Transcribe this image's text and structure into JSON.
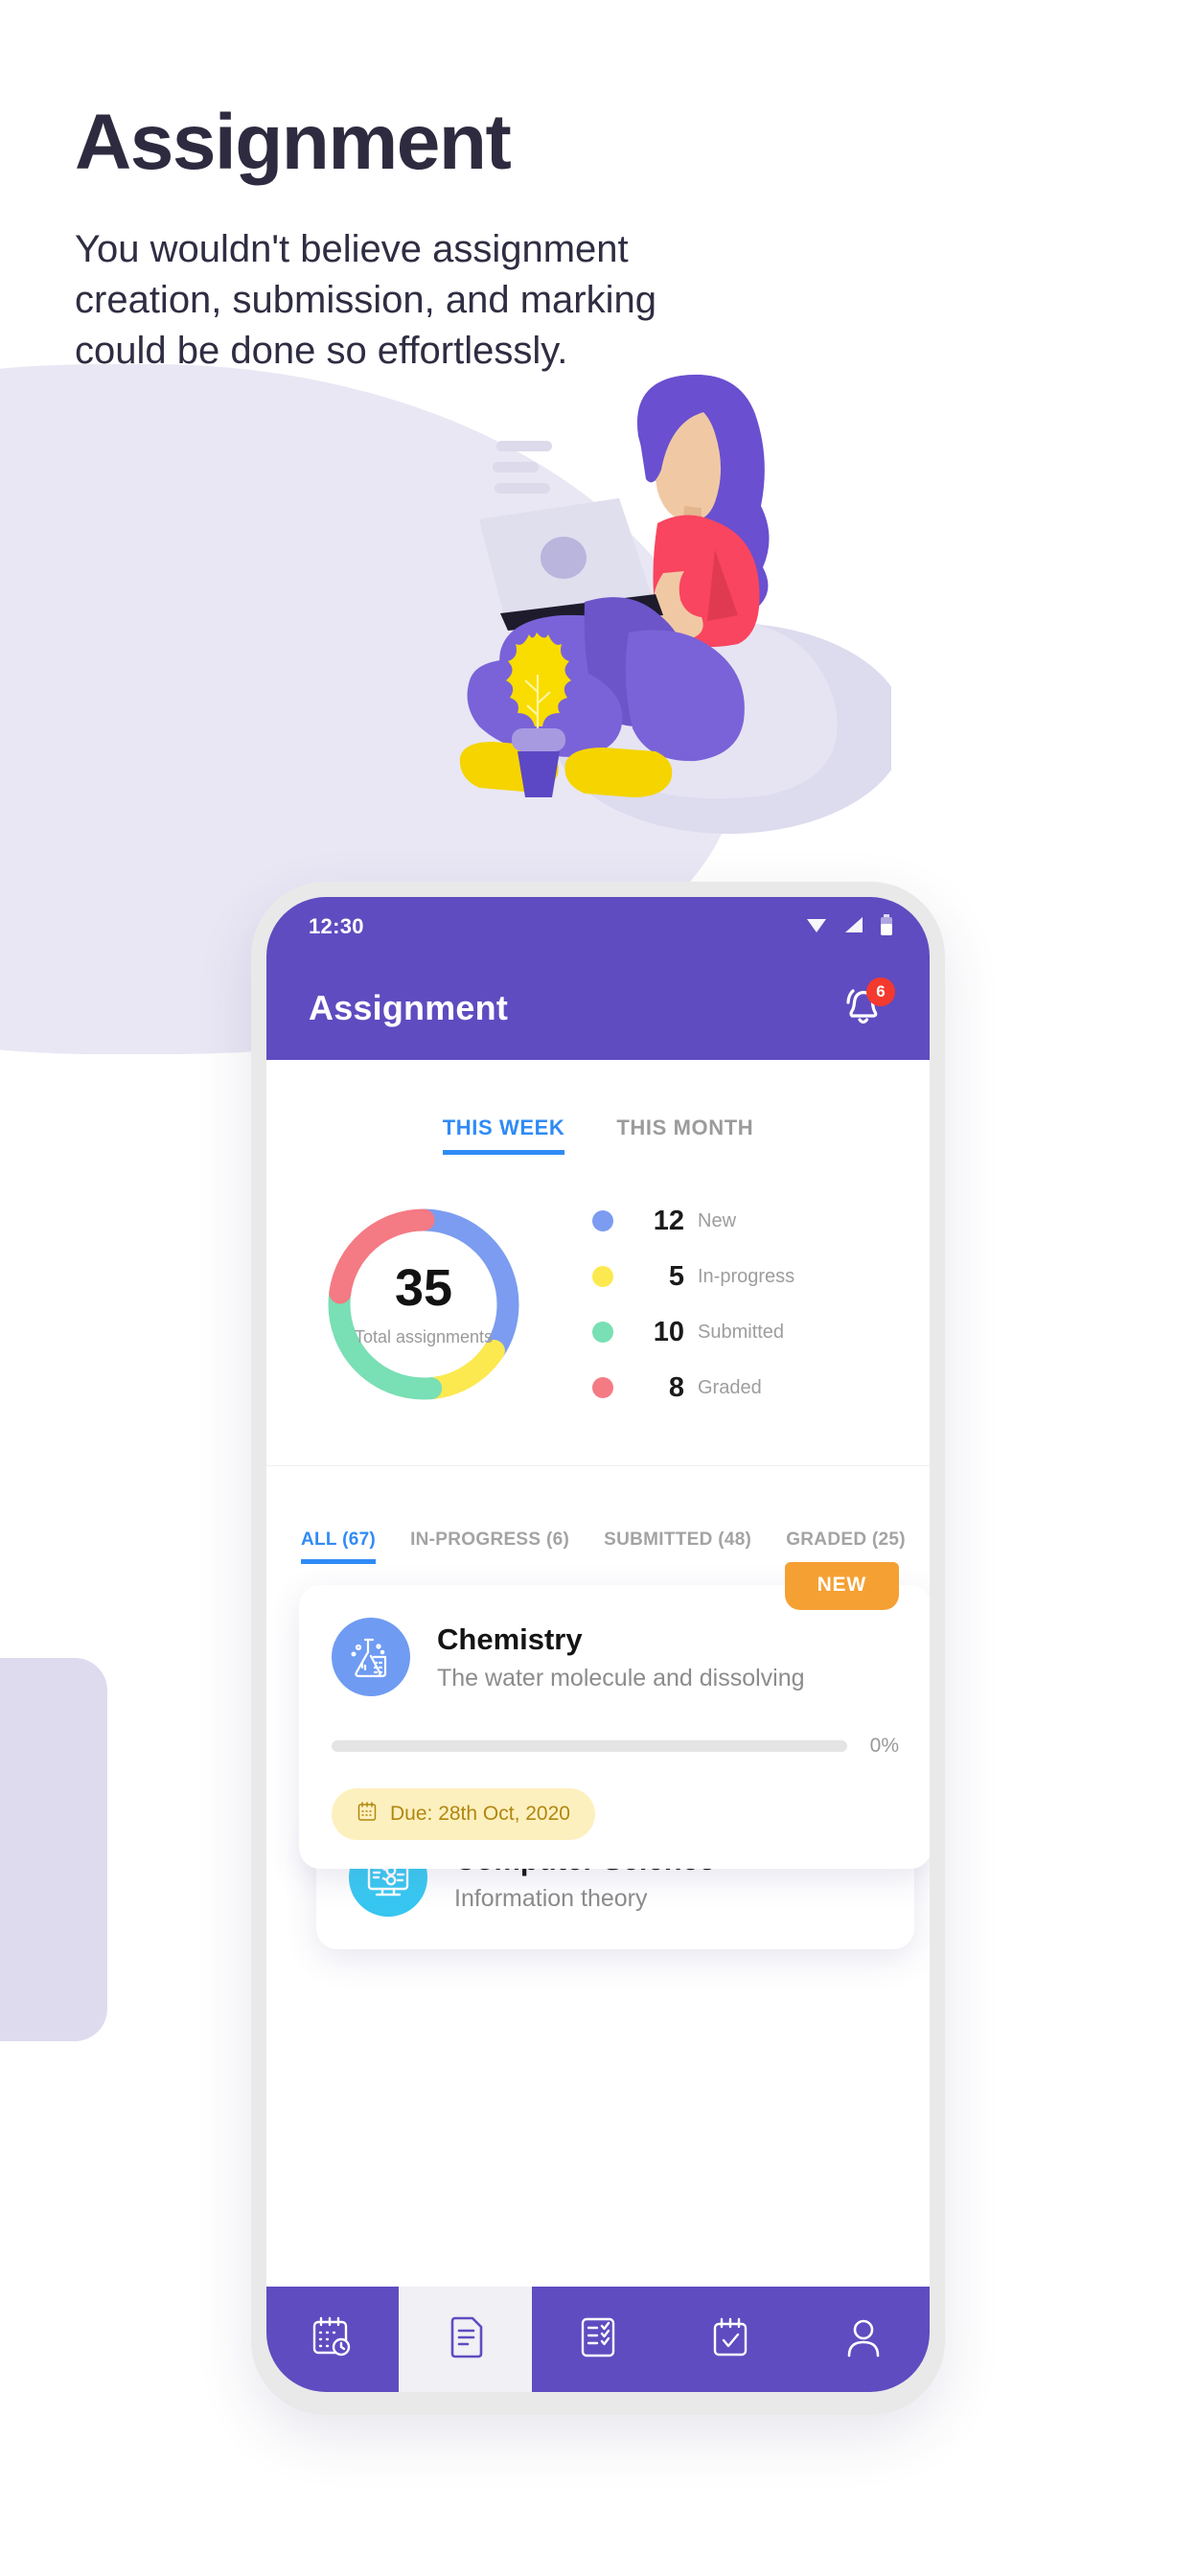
{
  "hero": {
    "title": "Assignment",
    "subtitle": "You wouldn't believe assignment creation, submission, and marking could be done so effortlessly."
  },
  "colors": {
    "brand_purple": "#5f4cc0",
    "accent_blue": "#2f8bf5",
    "badge_orange": "#f5a033",
    "badge_red": "#f4392f",
    "new": "#7b9cf0",
    "in_progress": "#fce94f",
    "submitted": "#79dfb4",
    "graded": "#f47a84",
    "due_pill_bg": "#fdf0bf",
    "due_pill_text": "#b0870f"
  },
  "phone": {
    "statusbar": {
      "time": "12:30",
      "icons": [
        "wifi-icon",
        "signal-icon",
        "battery-icon"
      ]
    },
    "appbar": {
      "title": "Assignment",
      "bell_icon": "bell-icon",
      "notification_count": "6"
    },
    "period_tabs": [
      {
        "label": "THIS WEEK",
        "active": true
      },
      {
        "label": "THIS MONTH",
        "active": false
      }
    ],
    "summary": {
      "total": "35",
      "total_label": "Total assignments"
    },
    "filter_tabs": [
      {
        "label": "ALL (67)",
        "active": true
      },
      {
        "label": "IN-PROGRESS (6)",
        "active": false
      },
      {
        "label": "SUBMITTED (48)",
        "active": false
      },
      {
        "label": "GRADED (25)",
        "active": false
      }
    ],
    "assignments": [
      {
        "subject": "Chemistry",
        "description": "The water molecule and dissolving",
        "icon": "chemistry-flask-icon",
        "badge": "NEW",
        "progress_pct": "0%",
        "progress_value": 0,
        "due": "Due: 28th Oct, 2020",
        "due_icon": "calendar-icon"
      },
      {
        "subject": "Computer Science",
        "description": "Information theory",
        "icon": "computer-monitor-icon"
      }
    ],
    "bottom_nav": [
      {
        "icon": "calendar-clock-icon",
        "active": false
      },
      {
        "icon": "document-icon",
        "active": true
      },
      {
        "icon": "checklist-icon",
        "active": false
      },
      {
        "icon": "calendar-check-icon",
        "active": false
      },
      {
        "icon": "person-icon",
        "active": false
      }
    ]
  },
  "chart_data": {
    "type": "pie",
    "title": "Total assignments",
    "center_value": 35,
    "categories": [
      "New",
      "In-progress",
      "Submitted",
      "Graded"
    ],
    "values": [
      12,
      5,
      10,
      8
    ],
    "colors": [
      "#7b9cf0",
      "#fce94f",
      "#79dfb4",
      "#f47a84"
    ],
    "legend_position": "right",
    "donut": true
  }
}
